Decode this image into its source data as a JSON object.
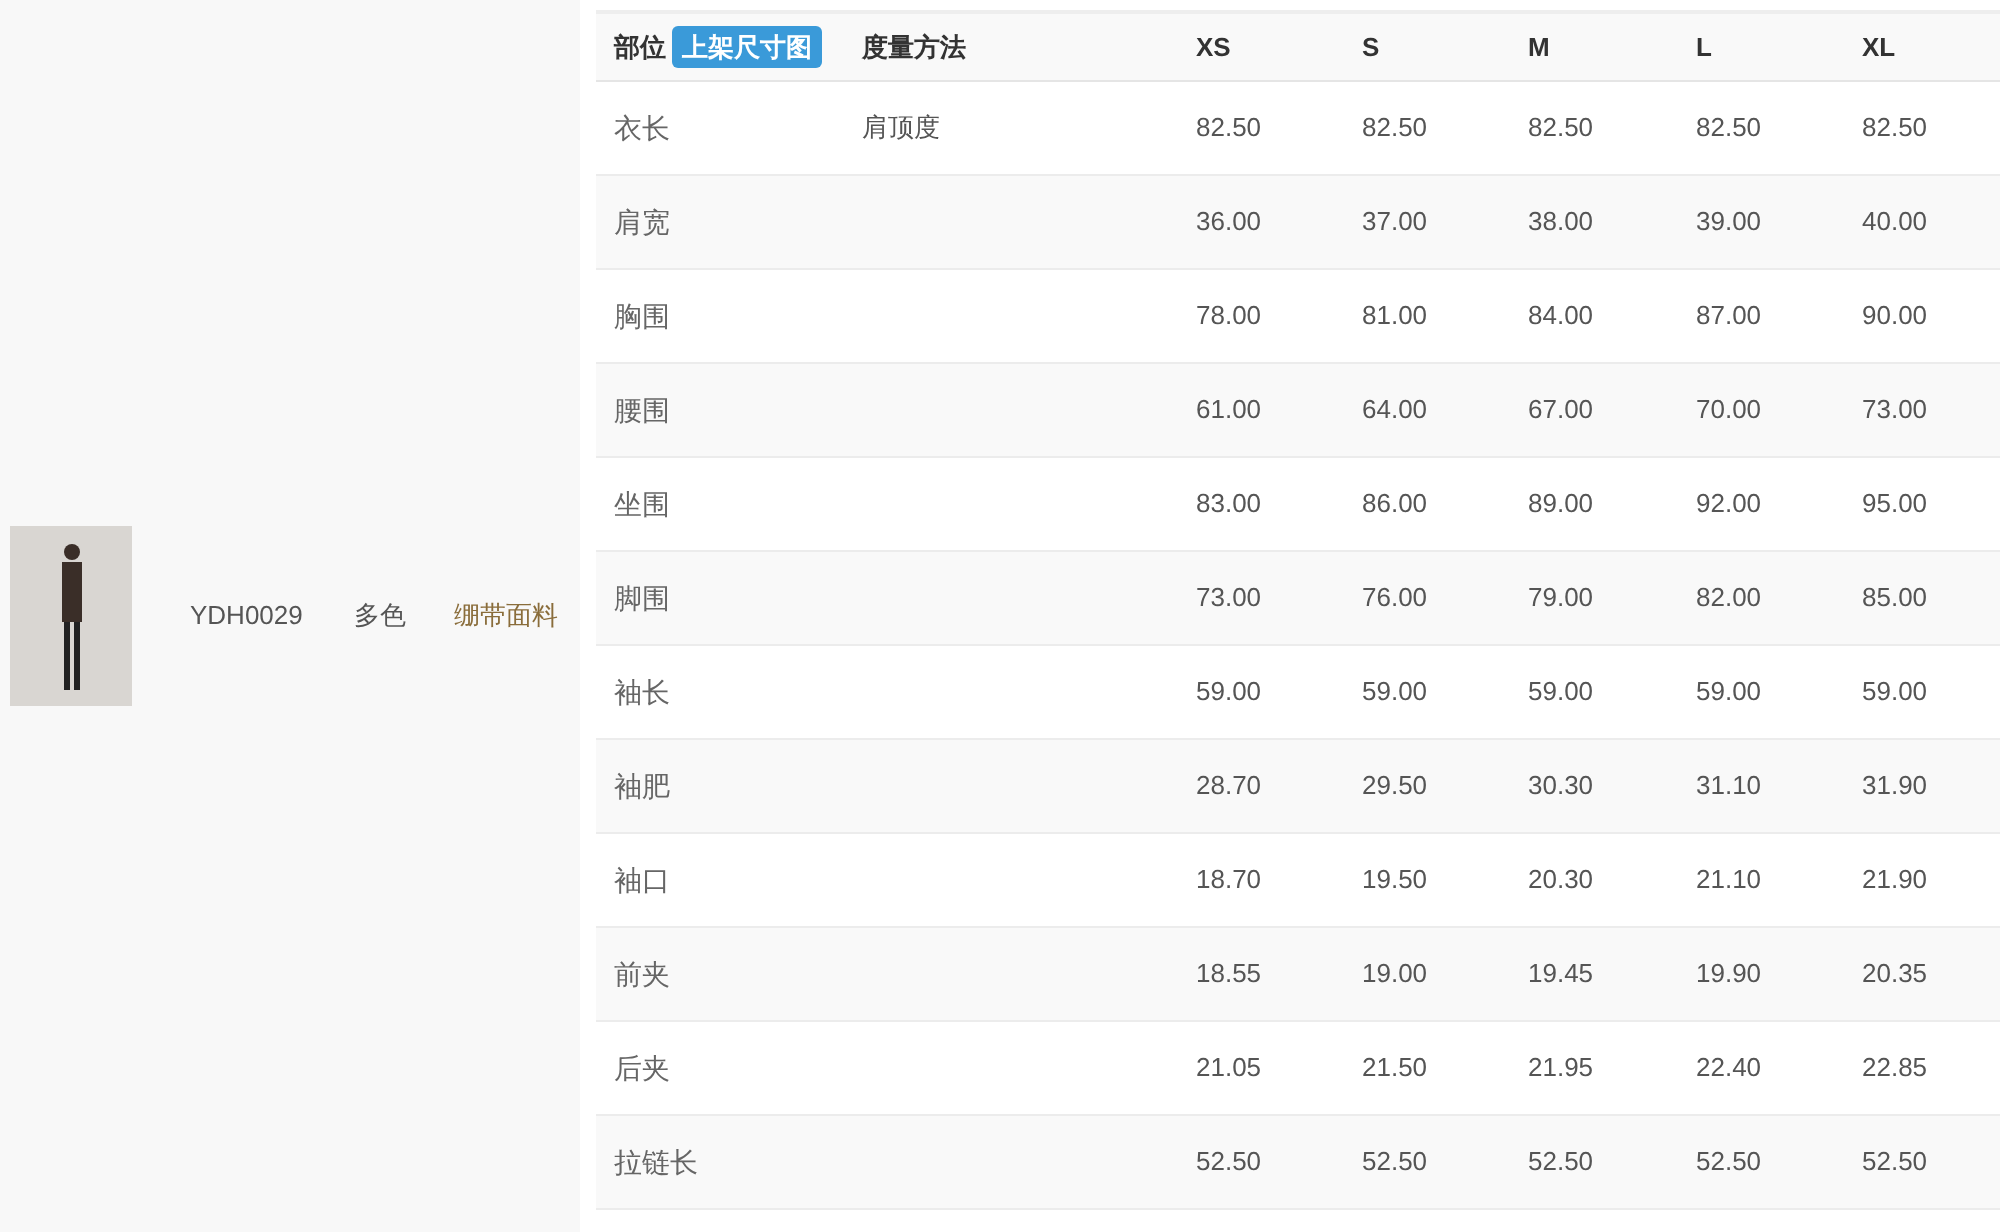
{
  "product": {
    "code": "YDH0029",
    "color_name": "多色",
    "material": "绷带面料"
  },
  "table": {
    "part_header": "部位",
    "part_badge": "上架尺寸图",
    "method_header": "度量方法",
    "sizes": [
      "XS",
      "S",
      "M",
      "L",
      "XL"
    ],
    "rows": [
      {
        "part": "衣长",
        "method": "肩顶度",
        "values": [
          "82.50",
          "82.50",
          "82.50",
          "82.50",
          "82.50"
        ]
      },
      {
        "part": "肩宽",
        "values": [
          "36.00",
          "37.00",
          "38.00",
          "39.00",
          "40.00"
        ]
      },
      {
        "part": "胸围",
        "values": [
          "78.00",
          "81.00",
          "84.00",
          "87.00",
          "90.00"
        ]
      },
      {
        "part": "腰围",
        "values": [
          "61.00",
          "64.00",
          "67.00",
          "70.00",
          "73.00"
        ]
      },
      {
        "part": "坐围",
        "values": [
          "83.00",
          "86.00",
          "89.00",
          "92.00",
          "95.00"
        ]
      },
      {
        "part": "脚围",
        "values": [
          "73.00",
          "76.00",
          "79.00",
          "82.00",
          "85.00"
        ]
      },
      {
        "part": "袖长",
        "values": [
          "59.00",
          "59.00",
          "59.00",
          "59.00",
          "59.00"
        ]
      },
      {
        "part": "袖肥",
        "values": [
          "28.70",
          "29.50",
          "30.30",
          "31.10",
          "31.90"
        ]
      },
      {
        "part": "袖口",
        "values": [
          "18.70",
          "19.50",
          "20.30",
          "21.10",
          "21.90"
        ]
      },
      {
        "part": "前夹",
        "values": [
          "18.55",
          "19.00",
          "19.45",
          "19.90",
          "20.35"
        ]
      },
      {
        "part": "后夹",
        "values": [
          "21.05",
          "21.50",
          "21.95",
          "22.40",
          "22.85"
        ]
      },
      {
        "part": "拉链长",
        "values": [
          "52.50",
          "52.50",
          "52.50",
          "52.50",
          "52.50"
        ]
      }
    ]
  }
}
